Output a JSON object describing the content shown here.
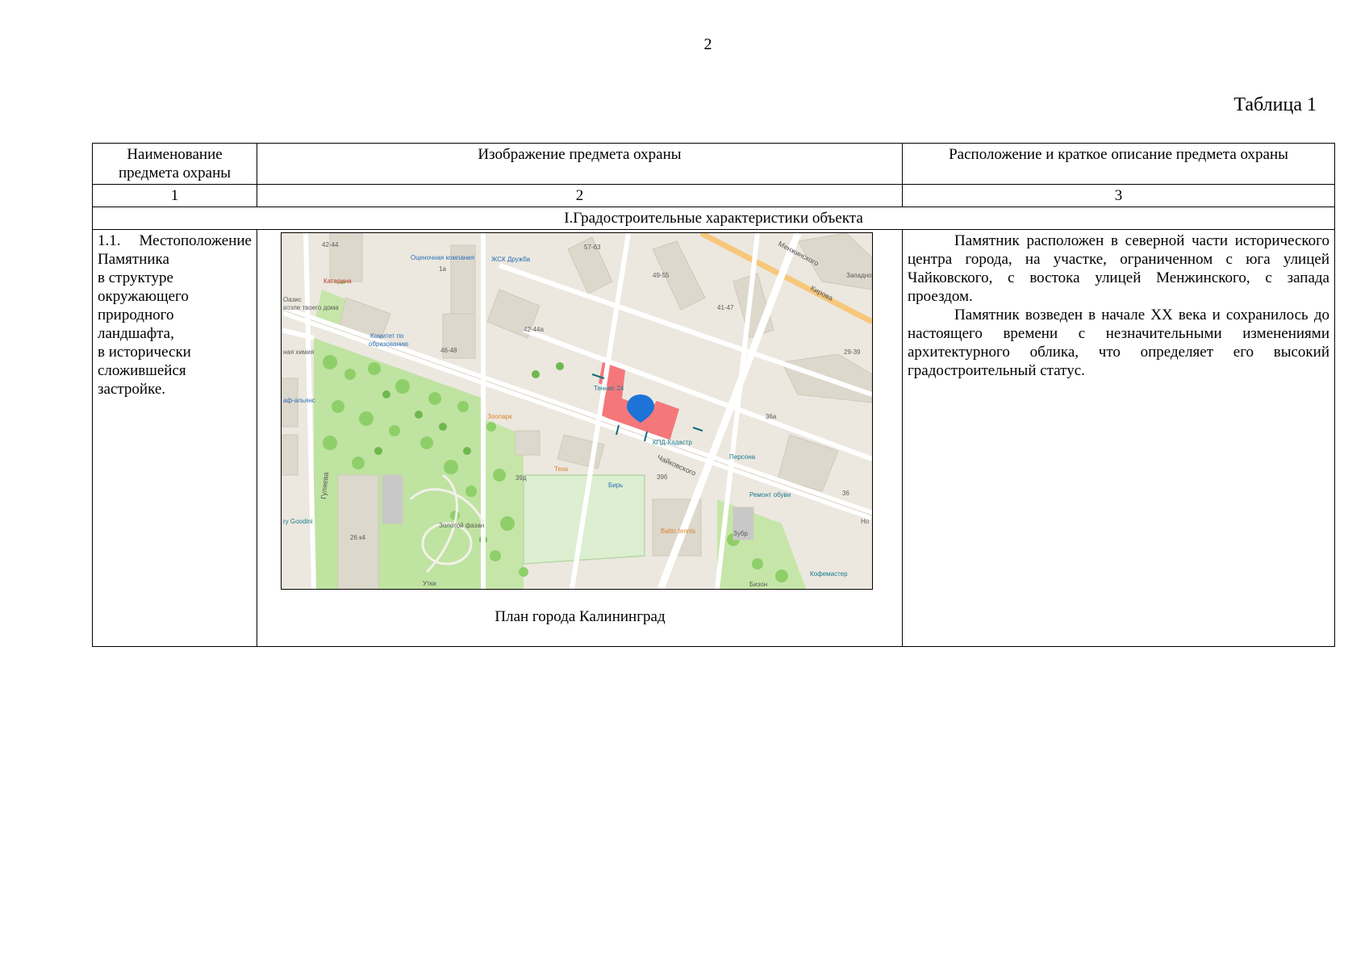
{
  "page_number": "2",
  "table_caption": "Таблица 1",
  "table": {
    "headers": [
      "Наименование предмета охраны",
      "Изображение предмета охраны",
      "Расположение и краткое описание предмета охраны"
    ],
    "column_numbers": [
      "1",
      "2",
      "3"
    ],
    "section_title": "I.Градостроительные характеристики объекта",
    "row": {
      "name_lines": [
        "1.1. Местоположение",
        "Памятника",
        "в структуре",
        "окружающего",
        "природного",
        "ландшафта,",
        "в исторически",
        "сложившейся",
        "застройке."
      ],
      "image_caption": "План города Калининград",
      "description": [
        "Памятник расположен в северной части исторического центра города, на участке, ограниченном с юга улицей Чайковского, с востока улицей Менжинского, с запада проездом.",
        "Памятник возведен в начале XX века и сохранилось до настоящего времени с незначительными изменениями архитектурного облика, что определяет его высокий градостроительный статус."
      ]
    }
  },
  "map": {
    "labels": {
      "b1": "42-44",
      "b2": "Катарина",
      "b3": "Оценочная компания",
      "b4": "ЖСК Дружба",
      "b5": "1а",
      "b6": "57-63",
      "b7": "Менжинского",
      "b8": "Кирова",
      "b9": "49-55",
      "b10": "Оазис",
      "b11": "возле твоего дома",
      "b12": "Комитет по",
      "b13": "образованию",
      "b14": "42-44а",
      "b15": "41-47",
      "b16": "Западно",
      "b17": "46-48",
      "b18": "ная химия",
      "b19": "29-39",
      "b20": "Теннис 24",
      "b21": "аф-альянс",
      "b22": "Зоопарк",
      "b23": "КПД-Кадастр",
      "b24": "36а",
      "b25": "Персона",
      "b26": "Чайковского",
      "b27": "Теха",
      "b28": "Бирь",
      "b29": "39б",
      "b30": "39д",
      "b31": "Ремонт обуви",
      "b32": "36",
      "b33": "ry Goodini",
      "b34": "26 к4",
      "b35": "Золотой фазан",
      "b36": "Baltic tennis",
      "b37": "Зубр",
      "b38": "Утки",
      "b39": "Бизон",
      "b40": "Кофемастер",
      "b41": "Гуляева",
      "b42": "Но"
    }
  }
}
